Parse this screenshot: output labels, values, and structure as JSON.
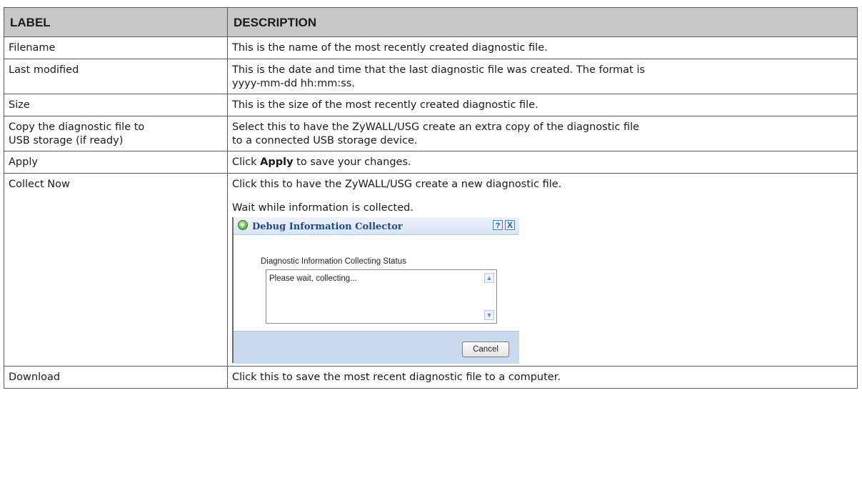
{
  "header": {
    "label": "LABEL",
    "description": "DESCRIPTION"
  },
  "rows": [
    {
      "label": "Filename",
      "description": "This is the name of the most recently created diagnostic file."
    },
    {
      "label": "Last modified",
      "description_line1": "This is the date and time that the last diagnostic file was created. The format is",
      "description_line2": "yyyy-mm-dd hh:mm:ss."
    },
    {
      "label": "Size",
      "description": "This is the size of the most recently created diagnostic file."
    },
    {
      "label_line1": "Copy the diagnostic file to",
      "label_line2": "USB storage (if ready)",
      "description_line1": "Select this to have the ZyWALL/USG create an extra copy of the diagnostic file",
      "description_line2": "to a connected USB storage device."
    },
    {
      "label": "Apply",
      "description_prefix": "Click ",
      "description_bold": "Apply",
      "description_suffix": " to save your changes."
    },
    {
      "label": "Collect Now",
      "description": "Click this to have the ZyWALL/USG create a new diagnostic file.",
      "description_2": "Wait while information is collected."
    },
    {
      "label": "Download",
      "description": "Click this to save the most recent diagnostic file to a computer."
    }
  ],
  "dialog": {
    "title": "Debug Information Collector",
    "help_icon": "?",
    "close_icon": "X",
    "status_label": "Diagnostic Information Collecting Status",
    "status_text": "Please wait, collecting...",
    "cancel_label": "Cancel"
  }
}
